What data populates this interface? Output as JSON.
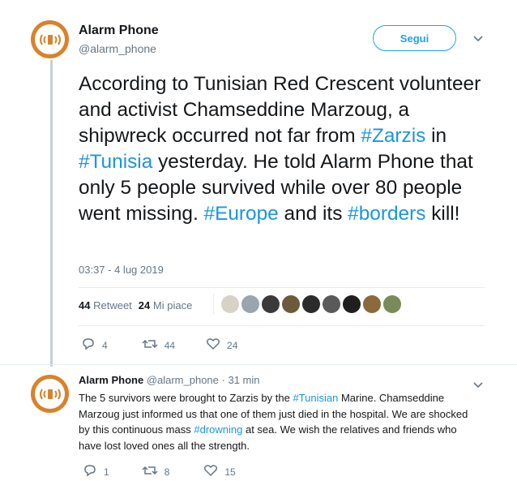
{
  "main_tweet": {
    "author_name": "Alarm Phone",
    "author_handle": "@alarm_phone",
    "follow_label": "Segui",
    "text_segments": [
      {
        "text": "According to Tunisian Red Crescent volunteer and activist Chamseddine Marzoug, a shipwreck occurred not far from ",
        "tag": false
      },
      {
        "text": "#Zarzis",
        "tag": true
      },
      {
        "text": " in ",
        "tag": false
      },
      {
        "text": "#Tunisia",
        "tag": true
      },
      {
        "text": " yesterday. He told Alarm Phone that only 5 people survived while over 80 people went missing. ",
        "tag": false
      },
      {
        "text": "#Europe",
        "tag": true
      },
      {
        "text": " and its ",
        "tag": false
      },
      {
        "text": "#borders",
        "tag": true
      },
      {
        "text": " kill!",
        "tag": false
      }
    ],
    "timestamp": "03:37 - 4 lug 2019",
    "retweet_count": "44",
    "retweet_label": "Retweet",
    "like_count": "24",
    "like_label": "Mi piace",
    "actions": {
      "replies": "4",
      "retweets": "44",
      "likes": "24"
    }
  },
  "reply_tweet": {
    "author_name": "Alarm Phone",
    "author_handle": "@alarm_phone",
    "time_ago": "· 31 min",
    "text_segments": [
      {
        "text": "The 5 survivors were brought to Zarzis by the ",
        "tag": false
      },
      {
        "text": "#Tunisian",
        "tag": true
      },
      {
        "text": " Marine. Chamseddine Marzoug just informed us that one of them just died in the hospital. We are shocked by this continuous mass ",
        "tag": false
      },
      {
        "text": "#drowning",
        "tag": true
      },
      {
        "text": " at sea. We wish the relatives and friends who have lost loved ones all the strength.",
        "tag": false
      }
    ],
    "actions": {
      "replies": "1",
      "retweets": "8",
      "likes": "15"
    }
  },
  "liker_avatars": [
    "#d8d2c4",
    "#9aa5ad",
    "#3a3a3a",
    "#6b5a3c",
    "#2b2b2b",
    "#5a5a5a",
    "#1f1f1f",
    "#8a6a3a",
    "#7a8a5a"
  ],
  "colors": {
    "brand_orange": "#d9822b",
    "link_blue": "#1b95e0",
    "follow_blue": "#1da1f2",
    "muted": "#657786"
  },
  "icons": [
    "phone-signal-icon",
    "chevron-down-icon",
    "reply-icon",
    "retweet-icon",
    "heart-icon"
  ]
}
